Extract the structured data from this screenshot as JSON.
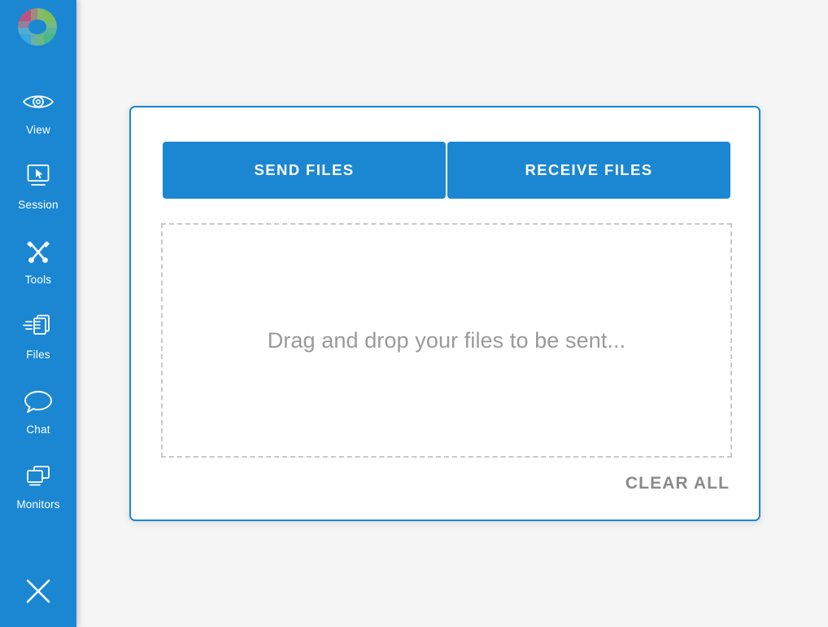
{
  "theme": {
    "accent_blue": "#1b87d2",
    "page_background": "#f5f5f5",
    "panel_background": "#ffffff",
    "muted_text": "#9a9a9a",
    "dashed_border": "#c9c9c9"
  },
  "sidebar": {
    "logo_name": "app-logo-torus",
    "items": [
      {
        "label": "View",
        "icon": "eye-icon"
      },
      {
        "label": "Session",
        "icon": "monitor-cursor-icon"
      },
      {
        "label": "Tools",
        "icon": "tools-wrench-screwdriver-icon"
      },
      {
        "label": "Files",
        "icon": "file-transfer-icon"
      },
      {
        "label": "Chat",
        "icon": "chat-bubble-icon"
      },
      {
        "label": "Monitors",
        "icon": "multiple-monitors-icon"
      }
    ],
    "close": {
      "label": "Close",
      "icon": "close-x-icon"
    }
  },
  "panel": {
    "send_files_label": "SEND FILES",
    "receive_files_label": "RECEIVE FILES",
    "drop_zone_text": "Drag and drop your files to be sent...",
    "clear_all_label": "CLEAR ALL"
  }
}
